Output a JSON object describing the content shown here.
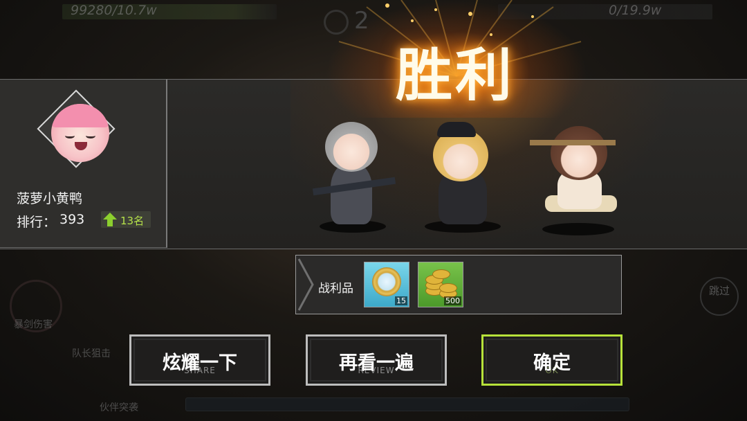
{
  "hud": {
    "left_power": "99280/10.7w",
    "right_power": "0/19.9w",
    "timer": "2",
    "skills": [
      "暴剑伤害",
      "队长狙击",
      "伙伴突袭"
    ],
    "skip": "跳过"
  },
  "victory": {
    "title": "胜利"
  },
  "player": {
    "name": "菠萝小黄鸭",
    "rank_label": "排行：",
    "rank_value": "393",
    "rank_change": "13名",
    "rank_change_color": "#b6e24a"
  },
  "loot": {
    "label": "战利品",
    "items": [
      {
        "icon": "medal-icon",
        "count": "15"
      },
      {
        "icon": "gold-coins-icon",
        "count": "500"
      }
    ]
  },
  "buttons": [
    {
      "label": "炫耀一下",
      "sub": "SHARE"
    },
    {
      "label": "再看一遍",
      "sub": "REVIEW"
    },
    {
      "label": "确定",
      "sub": "OK",
      "accent": "#b7e23a"
    }
  ]
}
